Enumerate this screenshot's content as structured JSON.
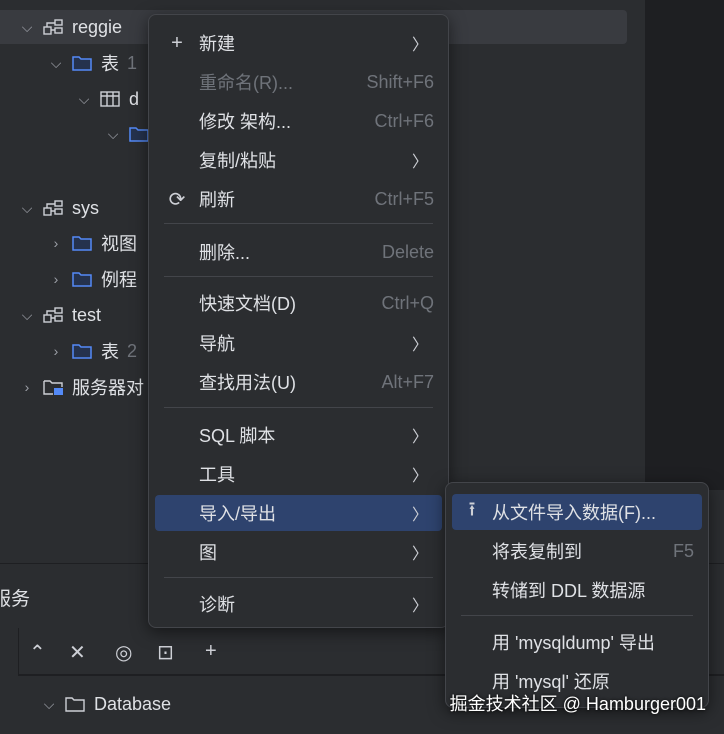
{
  "tree": [
    {
      "label": "reggie",
      "icon": "schema-icon",
      "expanded": true,
      "hint": ""
    },
    {
      "label": "表",
      "icon": "folder-icon",
      "expanded": true,
      "hint": "1"
    },
    {
      "label": "d",
      "icon": "table-icon",
      "expanded": true,
      "hint": ""
    },
    {
      "label": "",
      "icon": "folder-icon",
      "expanded": true,
      "hint": ""
    },
    {
      "label": "sys",
      "icon": "schema-icon",
      "expanded": true,
      "hint": ""
    },
    {
      "label": "视图",
      "icon": "folder-icon",
      "expanded": false,
      "hint": ""
    },
    {
      "label": "例程",
      "icon": "folder-icon",
      "expanded": false,
      "hint": ""
    },
    {
      "label": "test",
      "icon": "schema-icon",
      "expanded": true,
      "hint": ""
    },
    {
      "label": "表",
      "icon": "folder-icon",
      "expanded": false,
      "hint": "2"
    },
    {
      "label": "服务器对",
      "icon": "server-folder-icon",
      "expanded": false,
      "hint": ""
    }
  ],
  "menu": [
    {
      "label": "新建",
      "shortcut": "",
      "submenu": true
    },
    {
      "label": "重命名(R)...",
      "shortcut": "Shift+F6",
      "disabled": true
    },
    {
      "label": "修改 架构...",
      "shortcut": "Ctrl+F6"
    },
    {
      "label": "复制/粘贴",
      "submenu": true
    },
    {
      "label": "刷新",
      "shortcut": "Ctrl+F5"
    },
    {
      "label": "删除...",
      "shortcut": "Delete"
    },
    {
      "label": "快速文档(D)",
      "shortcut": "Ctrl+Q"
    },
    {
      "label": "导航",
      "submenu": true
    },
    {
      "label": "查找用法(U)",
      "shortcut": "Alt+F7"
    },
    {
      "label": "SQL 脚本",
      "submenu": true
    },
    {
      "label": "工具",
      "submenu": true
    },
    {
      "label": "导入/导出",
      "submenu": true,
      "highlighted": true
    },
    {
      "label": "图",
      "submenu": true
    },
    {
      "label": "诊断",
      "submenu": true
    }
  ],
  "submenu": [
    {
      "label": "从文件导入数据(F)...",
      "shortcut": "",
      "highlighted": true
    },
    {
      "label": "将表复制到",
      "shortcut": "F5"
    },
    {
      "label": "转储到 DDL 数据源",
      "shortcut": ""
    },
    {
      "label": "用 'mysqldump' 导出",
      "shortcut": ""
    },
    {
      "label": "用 'mysql' 还原",
      "shortcut": ""
    }
  ],
  "services": {
    "title": "服务",
    "database": "Database"
  },
  "watermark": "掘金技术社区 @ Hamburger001",
  "colors": {
    "highlight": "#2e436e",
    "folder": "#548af7"
  }
}
